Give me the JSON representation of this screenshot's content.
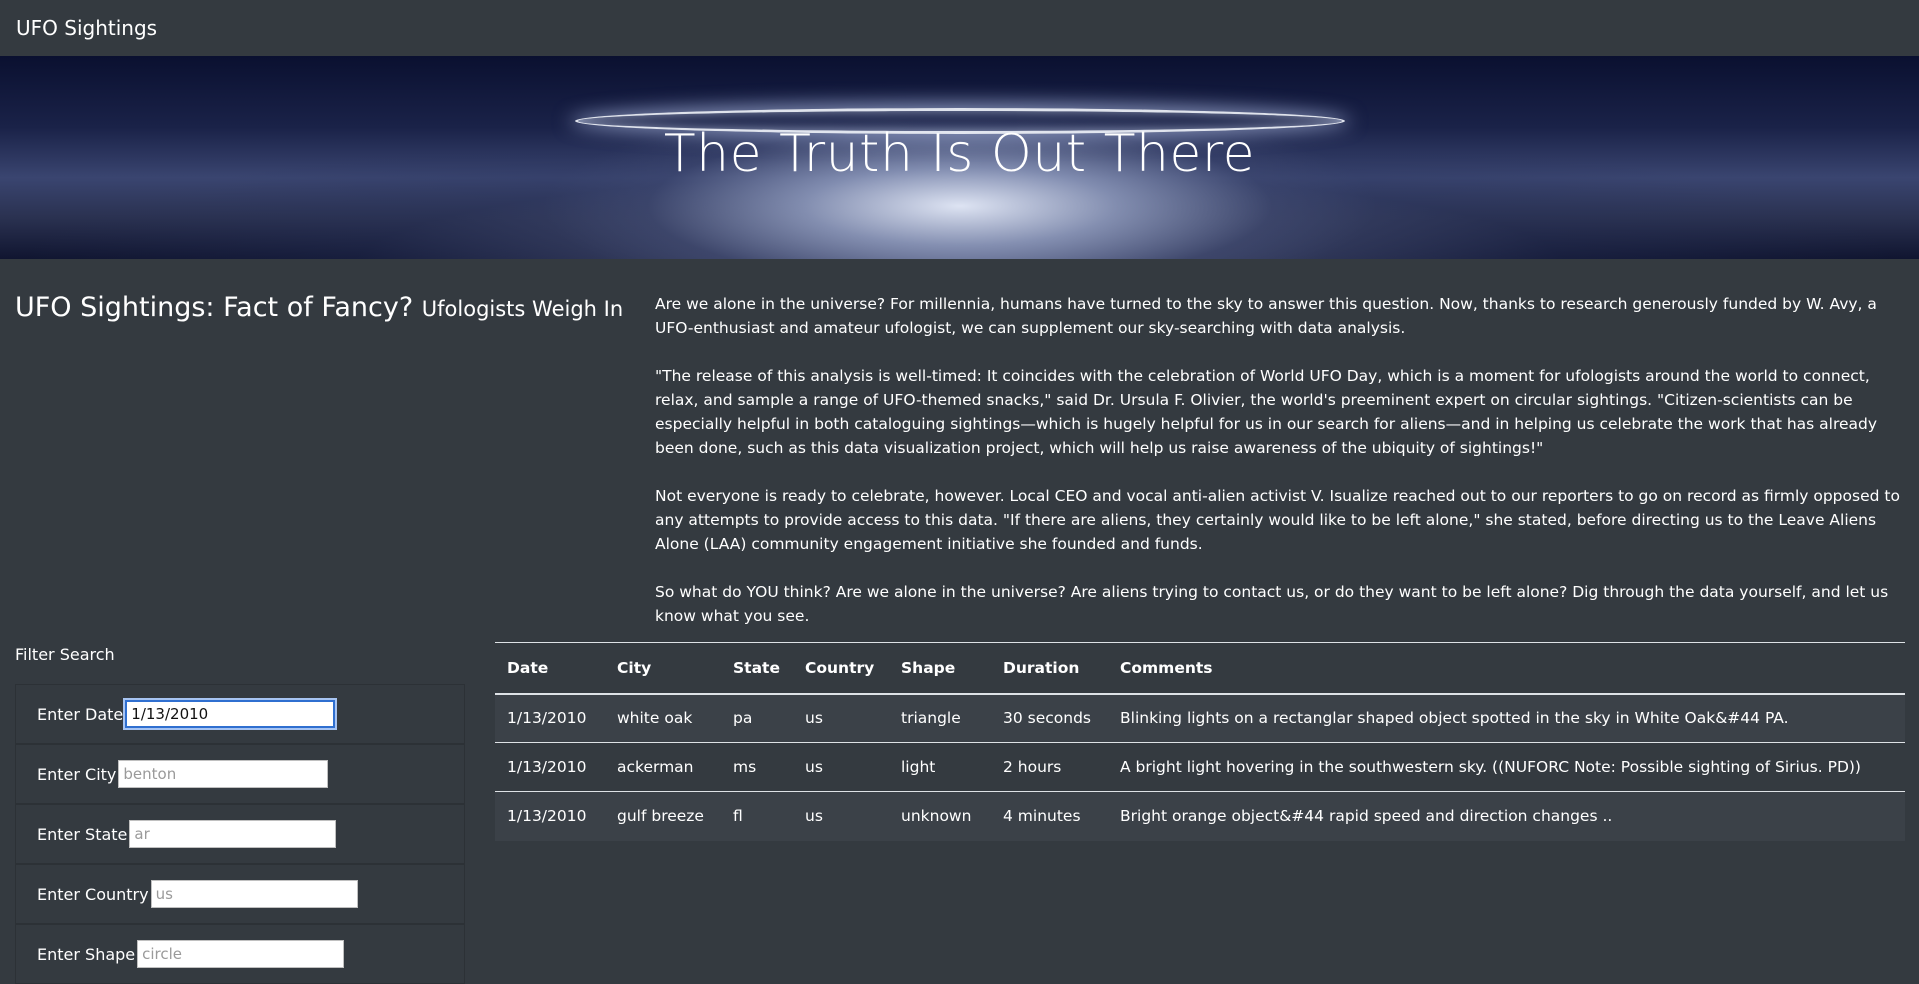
{
  "navbar": {
    "brand": "UFO Sightings"
  },
  "hero": {
    "title": "The Truth Is Out There"
  },
  "headline": {
    "main": "UFO Sightings: Fact of Fancy?",
    "sub": "Ufologists Weigh In"
  },
  "article": {
    "paragraphs": [
      "Are we alone in the universe? For millennia, humans have turned to the sky to answer this question. Now, thanks to research generously funded by W. Avy, a UFO-enthusiast and amateur ufologist, we can supplement our sky-searching with data analysis.",
      "\"The release of this analysis is well-timed: It coincides with the celebration of World UFO Day, which is a moment for ufologists around the world to connect, relax, and sample a range of UFO-themed snacks,\" said Dr. Ursula F. Olivier, the world's preeminent expert on circular sightings. \"Citizen-scientists can be especially helpful in both cataloguing sightings—which is hugely helpful for us in our search for aliens—and in helping us celebrate the work that has already been done, such as this data visualization project, which will help us raise awareness of the ubiquity of sightings!\"",
      "Not everyone is ready to celebrate, however. Local CEO and vocal anti-alien activist V. Isualize reached out to our reporters to go on record as firmly opposed to any attempts to provide access to this data. \"If there are aliens, they certainly would like to be left alone,\" she stated, before directing us to the Leave Aliens Alone (LAA) community engagement initiative she founded and funds.",
      "So what do YOU think? Are we alone in the universe? Are aliens trying to contact us, or do they want to be left alone? Dig through the data yourself, and let us know what you see."
    ]
  },
  "filters": {
    "title": "Filter Search",
    "date": {
      "label": "Enter Date",
      "value": "1/13/2010",
      "placeholder": ""
    },
    "city": {
      "label": "Enter City",
      "value": "",
      "placeholder": "benton"
    },
    "state": {
      "label": "Enter State",
      "value": "",
      "placeholder": "ar"
    },
    "country": {
      "label": "Enter Country",
      "value": "",
      "placeholder": "us"
    },
    "shape": {
      "label": "Enter Shape",
      "value": "",
      "placeholder": "circle"
    }
  },
  "table": {
    "headers": [
      "Date",
      "City",
      "State",
      "Country",
      "Shape",
      "Duration",
      "Comments"
    ],
    "rows": [
      [
        "1/13/2010",
        "white oak",
        "pa",
        "us",
        "triangle",
        "30 seconds",
        "Blinking lights on a rectanglar shaped object spotted in the sky in White Oak&#44 PA."
      ],
      [
        "1/13/2010",
        "ackerman",
        "ms",
        "us",
        "light",
        "2 hours",
        "A bright light hovering in the southwestern sky. ((NUFORC Note: Possible sighting of Sirius. PD))"
      ],
      [
        "1/13/2010",
        "gulf breeze",
        "fl",
        "us",
        "unknown",
        "4 minutes",
        "Bright orange object&#44 rapid speed and direction changes .."
      ]
    ]
  }
}
